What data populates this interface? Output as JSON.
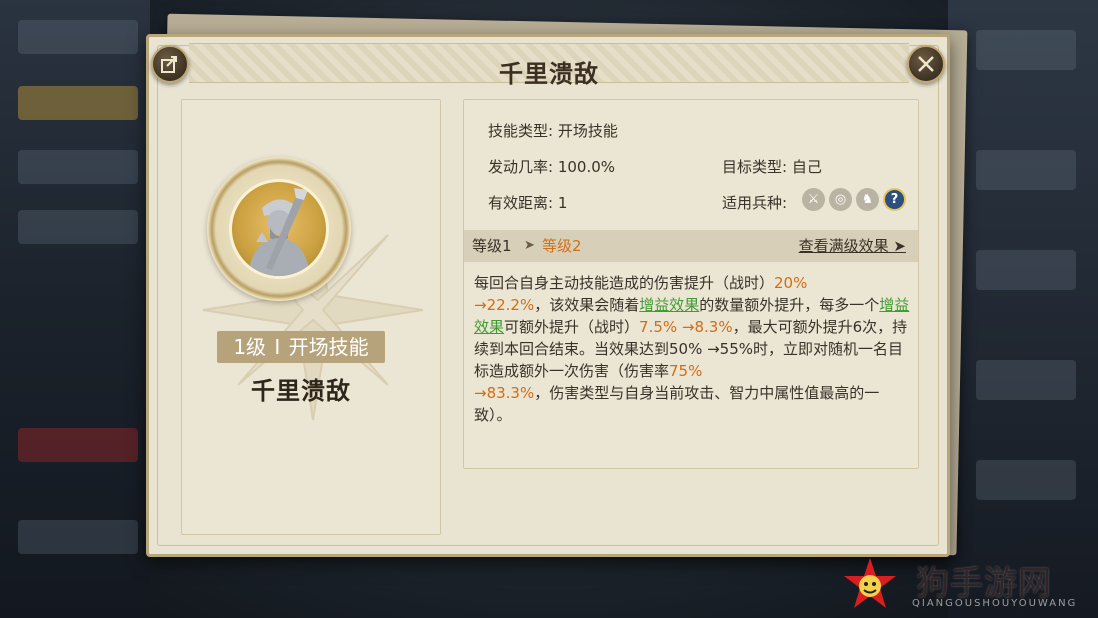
{
  "dialog": {
    "title": "千里溃敌",
    "share_icon": "share-icon",
    "close_icon": "close-icon"
  },
  "skill": {
    "level_num": "1级",
    "separator": "I",
    "type_badge": "开场技能",
    "name": "千里溃敌"
  },
  "info": {
    "skill_type_label": "技能类型:",
    "skill_type_value": "开场技能",
    "trigger_rate_label": "发动几率:",
    "trigger_rate_value": "100.0%",
    "target_type_label": "目标类型:",
    "target_type_value": "自己",
    "range_label": "有效距离:",
    "range_value": "1",
    "troops_label": "适用兵种:",
    "troops": [
      "spear-icon",
      "bow-icon",
      "cavalry-icon",
      "question-icon"
    ]
  },
  "levels": {
    "from": "等级1",
    "arrow": "➤",
    "to": "等级2",
    "view_max": "查看满级效果 ➤"
  },
  "description": {
    "p1": "每回合自身主动技能造成的伤害提升（战时）",
    "v1": "20%",
    "v1b": "→22.2%",
    "p2": "，该效果会随着",
    "buff1": "增益效果",
    "p3": "的数量额外提升，每多一个",
    "buff2": "增益效果",
    "p4": "可额外提升（战时）",
    "v2": "7.5% →8.3%",
    "p5": "，最大可额外提升6次，持续到本回合结束。当效果达到50% →55%时，立即对随机一名目标造成额外一次伤害（伤害率",
    "v3": "75%",
    "v3b": "→83.3%",
    "p6": "，伤害类型与自身当前攻击、智力中属性值最高的一致）。"
  },
  "watermark": {
    "text": "狗手游网",
    "sub": "QIANGOUSHOUYOUWANG"
  },
  "colors": {
    "accent_orange": "#d06e16",
    "accent_green": "#3f9c32",
    "panel_bg": "#e9e3d2"
  }
}
